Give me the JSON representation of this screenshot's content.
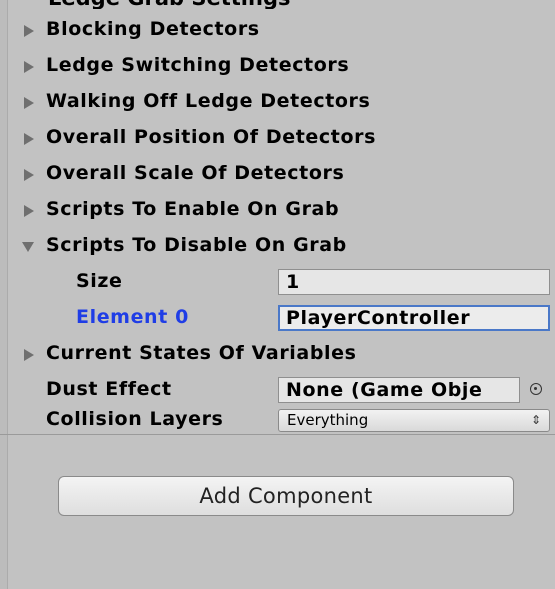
{
  "inspector": {
    "top_sliver_text": "Ledge Grab Settings",
    "foldouts": [
      {
        "label": "Blocking Detectors",
        "expanded": false
      },
      {
        "label": "Ledge Switching Detectors",
        "expanded": false
      },
      {
        "label": "Walking Off Ledge Detectors",
        "expanded": false
      },
      {
        "label": "Overall Position Of Detectors",
        "expanded": false
      },
      {
        "label": "Overall Scale Of Detectors",
        "expanded": false
      },
      {
        "label": "Scripts To Enable On Grab",
        "expanded": false
      },
      {
        "label": "Scripts To Disable On Grab",
        "expanded": true
      }
    ],
    "size": {
      "label": "Size",
      "value": "1"
    },
    "element0": {
      "label": "Element 0",
      "value": "PlayerController"
    },
    "current_states": {
      "label": "Current States Of Variables",
      "expanded": false
    },
    "dust_effect": {
      "label": "Dust Effect",
      "value": "None (Game Obje"
    },
    "collision_layers": {
      "label": "Collision Layers",
      "value": "Everything"
    },
    "add_component_label": "Add Component",
    "colors": {
      "background": "#c2c2c2",
      "active_label": "#1f3de6",
      "field_focus_border": "#4a78c8"
    }
  }
}
